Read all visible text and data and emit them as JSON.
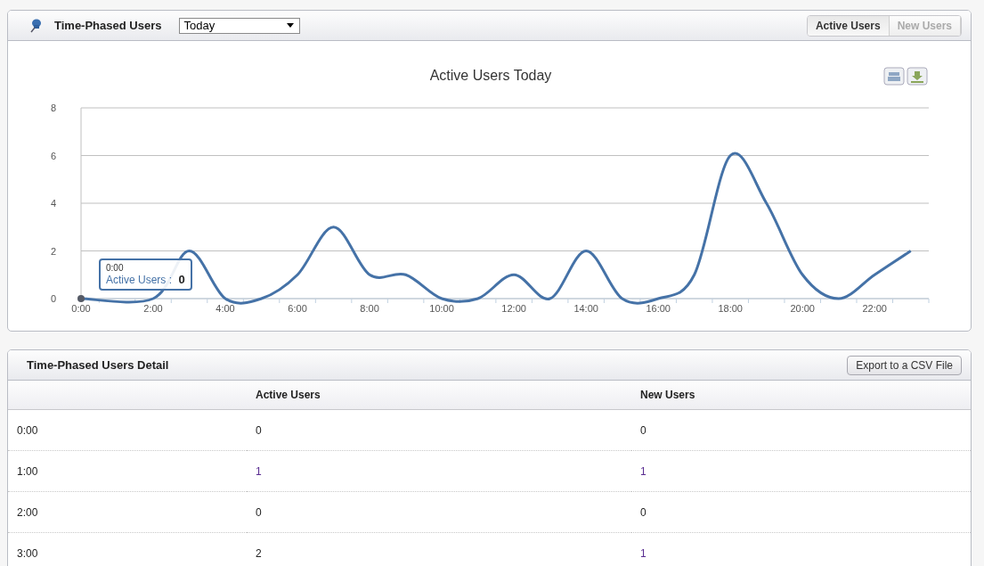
{
  "chart_panel": {
    "title": "Time-Phased Users",
    "period": "Today",
    "toggle": [
      {
        "label": "Active Users",
        "selected": true
      },
      {
        "label": "New Users",
        "selected": false
      }
    ],
    "chart_data": {
      "type": "line",
      "title": "Active Users Today",
      "x": [
        0,
        1,
        2,
        3,
        4,
        5,
        6,
        7,
        8,
        9,
        10,
        11,
        12,
        13,
        14,
        15,
        16,
        17,
        18,
        19,
        20,
        21,
        22,
        23
      ],
      "series": [
        {
          "name": "Active Users",
          "color": "#4572a7",
          "values": [
            0,
            null,
            0,
            2,
            0,
            0,
            1,
            3,
            1,
            1,
            0,
            0,
            1,
            0,
            2,
            0,
            0,
            1,
            6,
            4,
            1,
            0,
            1,
            2
          ]
        }
      ],
      "xlim": [
        0,
        23.5
      ],
      "ylim": [
        0,
        8
      ],
      "yticks": [
        0,
        2,
        4,
        6,
        8
      ],
      "grid": true,
      "xticks": [
        {
          "value": 0,
          "label": "0:00"
        },
        {
          "value": 2,
          "label": "2:00"
        },
        {
          "value": 4,
          "label": "4:00"
        },
        {
          "value": 6,
          "label": "6:00"
        },
        {
          "value": 8,
          "label": "8:00"
        },
        {
          "value": 10,
          "label": "10:00"
        },
        {
          "value": 12,
          "label": "12:00"
        },
        {
          "value": 14,
          "label": "14:00"
        },
        {
          "value": 16,
          "label": "16:00"
        },
        {
          "value": 18,
          "label": "18:00"
        },
        {
          "value": 20,
          "label": "20:00"
        },
        {
          "value": 22,
          "label": "22:00"
        }
      ]
    },
    "tooltip": {
      "time": "0:00",
      "separator": ":",
      "value": "0"
    }
  },
  "detail_panel": {
    "title": "Time-Phased Users Detail",
    "export_button": "Export to a CSV File",
    "columns": [
      "Active Users",
      "New Users"
    ],
    "rows": [
      {
        "time": "0:00",
        "cells": [
          {
            "text": "0",
            "link": false
          },
          {
            "text": "0",
            "link": false
          }
        ]
      },
      {
        "time": "1:00",
        "cells": [
          {
            "text": "1",
            "link": true
          },
          {
            "text": "1",
            "link": true
          }
        ]
      },
      {
        "time": "2:00",
        "cells": [
          {
            "text": "0",
            "link": false
          },
          {
            "text": "0",
            "link": false
          }
        ]
      },
      {
        "time": "3:00",
        "cells": [
          {
            "text": "2",
            "link": false
          },
          {
            "text": "1",
            "link": true
          }
        ]
      }
    ]
  }
}
